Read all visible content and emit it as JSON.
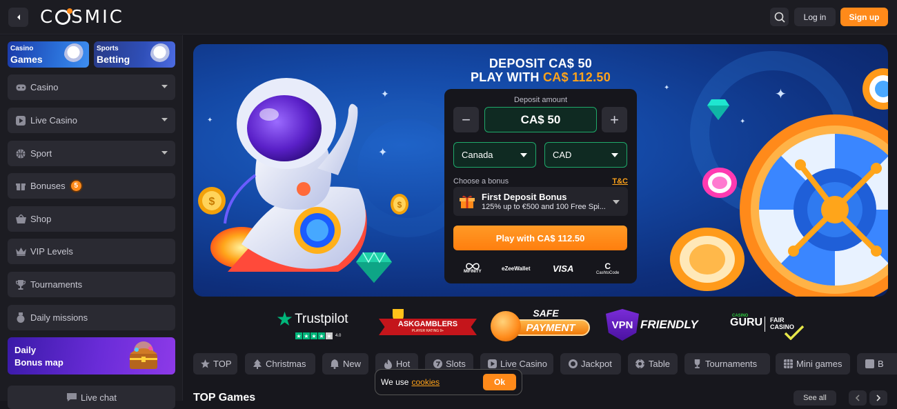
{
  "header": {
    "logo_text": "CSMIC",
    "login_label": "Log in",
    "signup_label": "Sign up"
  },
  "sidebar": {
    "promos": [
      {
        "small": "Casino",
        "big": "Games"
      },
      {
        "small": "Sports",
        "big": "Betting"
      }
    ],
    "items": [
      {
        "label": "Casino",
        "icon": "gamepad-icon",
        "has_chevron": true
      },
      {
        "label": "Live Casino",
        "icon": "play-icon",
        "has_chevron": true
      },
      {
        "label": "Sport",
        "icon": "basketball-icon",
        "has_chevron": true
      },
      {
        "label": "Bonuses",
        "icon": "gift-icon",
        "badge": "5"
      },
      {
        "label": "Shop",
        "icon": "basket-icon"
      },
      {
        "label": "VIP Levels",
        "icon": "crown-icon"
      },
      {
        "label": "Tournaments",
        "icon": "trophy-icon"
      },
      {
        "label": "Daily missions",
        "icon": "medal-icon"
      }
    ],
    "bonus_map": {
      "line1": "Daily",
      "line2": "Bonus map"
    },
    "live_chat": "Live chat"
  },
  "hero": {
    "headline_line1": "DEPOSIT CA$ 50",
    "headline_line2_prefix": "PLAY WITH ",
    "headline_line2_amount": "CA$ 112.50",
    "panel": {
      "deposit_label": "Deposit amount",
      "amount_value": "CA$ 50",
      "minus": "−",
      "plus": "+",
      "country": "Canada",
      "currency": "CAD",
      "choose_bonus_label": "Choose a bonus",
      "tc_label": "T&C",
      "bonus_title": "First Deposit Bonus",
      "bonus_desc": "125% up to €500 and 100 Free Spi...",
      "play_button": "Play with CA$ 112.50",
      "payments": [
        "MIFINITY",
        "eZeeWallet",
        "VISA",
        "CashtoCode"
      ]
    }
  },
  "trust": {
    "trustpilot": "Trustpilot",
    "trustpilot_score": "4.0",
    "askgamblers": "ASKGAMBLERS",
    "askgamblers_sub": "PLAYER RATING 9+",
    "safe_top": "SAFE",
    "safe_bottom": "PAYMENT",
    "vpn_shield": "VPN",
    "vpn_text": "FRIENDLY",
    "guru_small": "CASINO",
    "guru_big": "GURU",
    "guru_fair": "FAIR",
    "guru_casino": "CASINO"
  },
  "categories": [
    {
      "label": "TOP",
      "icon": "star-icon"
    },
    {
      "label": "Christmas",
      "icon": "tree-icon"
    },
    {
      "label": "New",
      "icon": "bell-icon"
    },
    {
      "label": "Hot",
      "icon": "flame-icon"
    },
    {
      "label": "Slots",
      "icon": "seven-icon"
    },
    {
      "label": "Live Casino",
      "icon": "play-icon"
    },
    {
      "label": "Jackpot",
      "icon": "coin-icon"
    },
    {
      "label": "Table",
      "icon": "chip-icon"
    },
    {
      "label": "Tournaments",
      "icon": "trophy-icon"
    },
    {
      "label": "Mini games",
      "icon": "grid-icon"
    },
    {
      "label": "B",
      "icon": "grid-icon"
    }
  ],
  "cookie": {
    "text": "We use",
    "link": "cookies",
    "ok": "Ok"
  },
  "section": {
    "title": "TOP Games",
    "see_all": "See all"
  },
  "colors": {
    "accent": "#ff8a1a",
    "green": "#1faa6b",
    "bg": "#17171d",
    "panel": "#2a2a32"
  }
}
